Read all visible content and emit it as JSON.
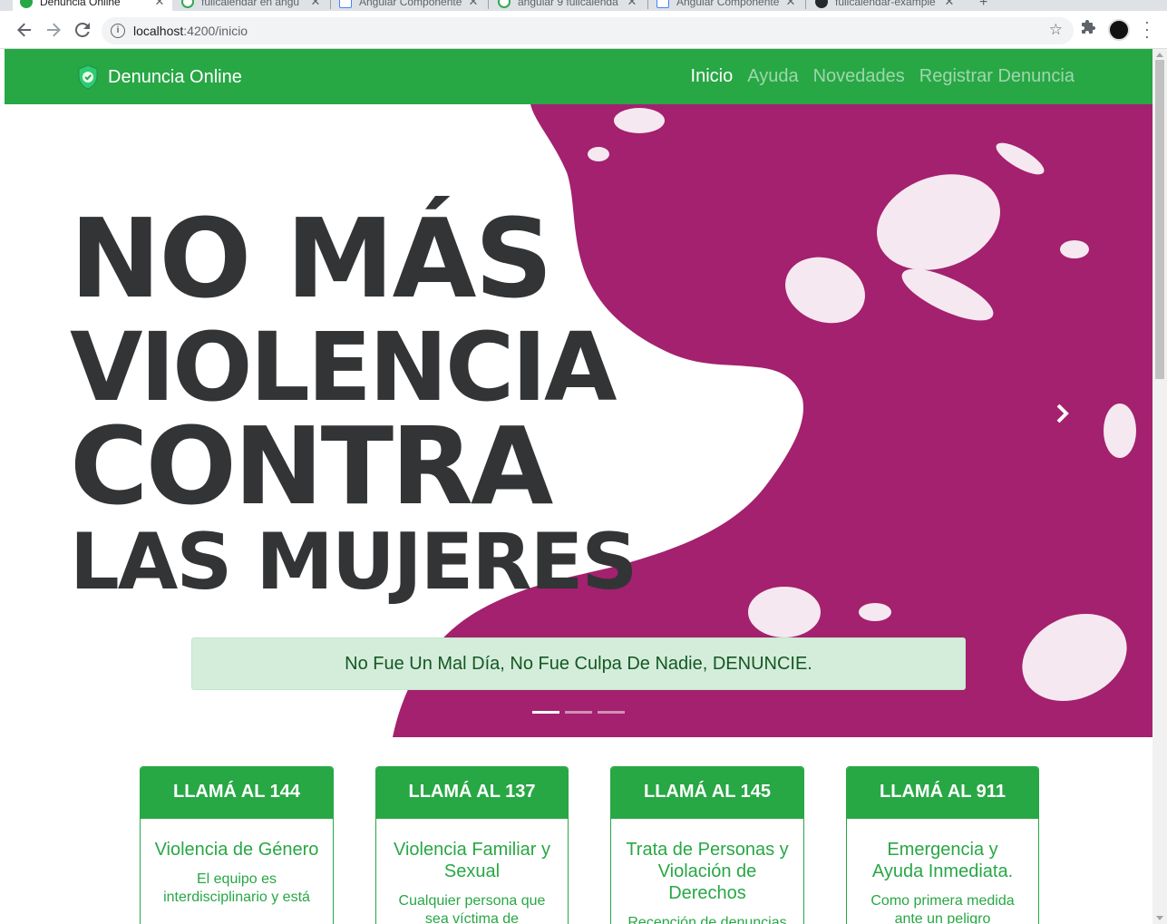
{
  "browser": {
    "tabs": [
      {
        "title": "Denuncia Online",
        "active": true,
        "favicon": "shield-favicon"
      },
      {
        "title": "fullcalendar en angu",
        "active": false,
        "favicon": "green-circle-favicon"
      },
      {
        "title": "Angular Componente",
        "active": false,
        "favicon": "doc-favicon"
      },
      {
        "title": "angular 9 fullcalenda",
        "active": false,
        "favicon": "green-circle-favicon"
      },
      {
        "title": "Angular Componente",
        "active": false,
        "favicon": "doc-favicon"
      },
      {
        "title": "fullcalendar-example",
        "active": false,
        "favicon": "github-favicon"
      }
    ],
    "url_host": "localhost",
    "url_path": ":4200/inicio"
  },
  "navbar": {
    "brand": "Denuncia Online",
    "links": [
      "Inicio",
      "Ayuda",
      "Novedades",
      "Registrar Denuncia"
    ],
    "active_link": "Inicio",
    "color": "#28a745"
  },
  "carousel": {
    "headline": [
      "NO MÁS",
      "VIOLENCIA",
      "CONTRA",
      "LAS MUJERES"
    ],
    "caption": "No Fue Un Mal Día, No Fue Culpa De Nadie, DENUNCIE.",
    "slide_count": 3,
    "active_slide": 1,
    "accent_color": "#a3216e"
  },
  "cards": [
    {
      "header": "LLAMÁ AL 144",
      "title": "Violencia de Género",
      "text": "El equipo es interdisciplinario y está"
    },
    {
      "header": "LLAMÁ AL 137",
      "title": "Violencia Familiar y Sexual",
      "text": "Cualquier persona que sea víctima de"
    },
    {
      "header": "LLAMÁ AL 145",
      "title": "Trata de Personas y Violación de Derechos",
      "text": "Recepción de denuncias las"
    },
    {
      "header": "LLAMÁ AL 911",
      "title": "Emergencia y Ayuda Inmediata.",
      "text": "Como primera medida ante un peligro"
    }
  ]
}
